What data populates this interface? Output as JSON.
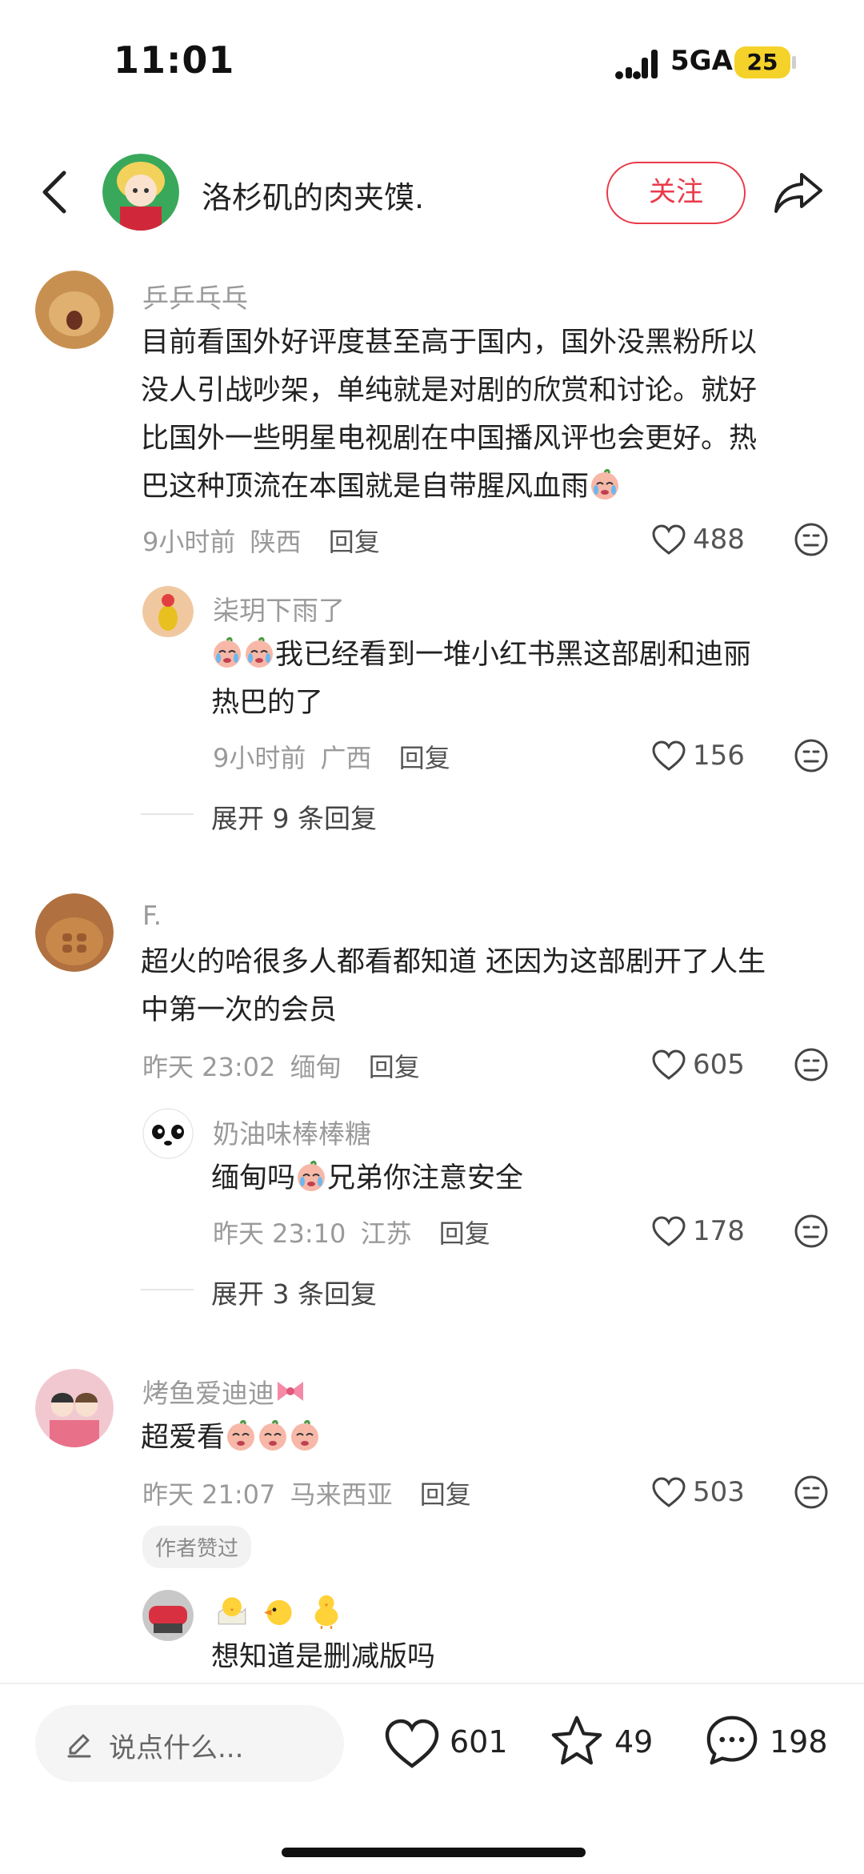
{
  "status_bar": {
    "time": "11:01",
    "network": "5GA",
    "battery": "25"
  },
  "header": {
    "title": "洛杉矶的肉夹馍.",
    "follow_label": "关注"
  },
  "comments": [
    {
      "username": "乒乒乓乓",
      "text_lines": [
        "目前看国外好评度甚至高于国内，国外没黑粉所以",
        "没人引战吵架，单纯就是对剧的欣赏和讨论。就好",
        "比国外一些明星电视剧在中国播风评也会更好。热",
        "巴这种顶流在本国就是自带腥风血雨"
      ],
      "time": "9小时前",
      "location": "陕西",
      "reply_label": "回复",
      "likes": "488",
      "sub": {
        "username": "柒玥下雨了",
        "text_lines": [
          "我已经看到一堆小红书黑这部剧和迪丽",
          "热巴的了"
        ],
        "time": "9小时前",
        "location": "广西",
        "reply_label": "回复",
        "likes": "156"
      },
      "expand": "展开 9 条回复"
    },
    {
      "username": "F.",
      "text_lines": [
        "超火的哈很多人都看都知道 还因为这部剧开了人生",
        "中第一次的会员"
      ],
      "time": "昨天 23:02",
      "location": "缅甸",
      "reply_label": "回复",
      "likes": "605",
      "sub": {
        "username": "奶油味棒棒糖",
        "text_a": "缅甸吗",
        "text_b": "兄弟你注意安全",
        "time": "昨天 23:10",
        "location": "江苏",
        "reply_label": "回复",
        "likes": "178"
      },
      "expand": "展开 3 条回复"
    },
    {
      "username": "烤鱼爱迪迪",
      "text": "超爱看",
      "time": "昨天 21:07",
      "location": "马来西亚",
      "reply_label": "回复",
      "likes": "503",
      "badge": "作者赞过",
      "sub": {
        "text": "想知道是删减版吗"
      }
    }
  ],
  "bottom_bar": {
    "input_placeholder": "说点什么...",
    "likes": "601",
    "stars": "49",
    "comments": "198"
  },
  "colors": {
    "accent": "#ea3a4a",
    "muted": "#9a9a9a",
    "badge_bg": "#f2f2f2",
    "battery": "#f5d22a"
  },
  "icons": [
    "back-icon",
    "share-icon",
    "heart-icon",
    "emoji-face-icon",
    "star-icon",
    "comment-bubble-icon",
    "pencil-icon",
    "crying-emoji",
    "chick-emoji",
    "bow-emoji"
  ]
}
